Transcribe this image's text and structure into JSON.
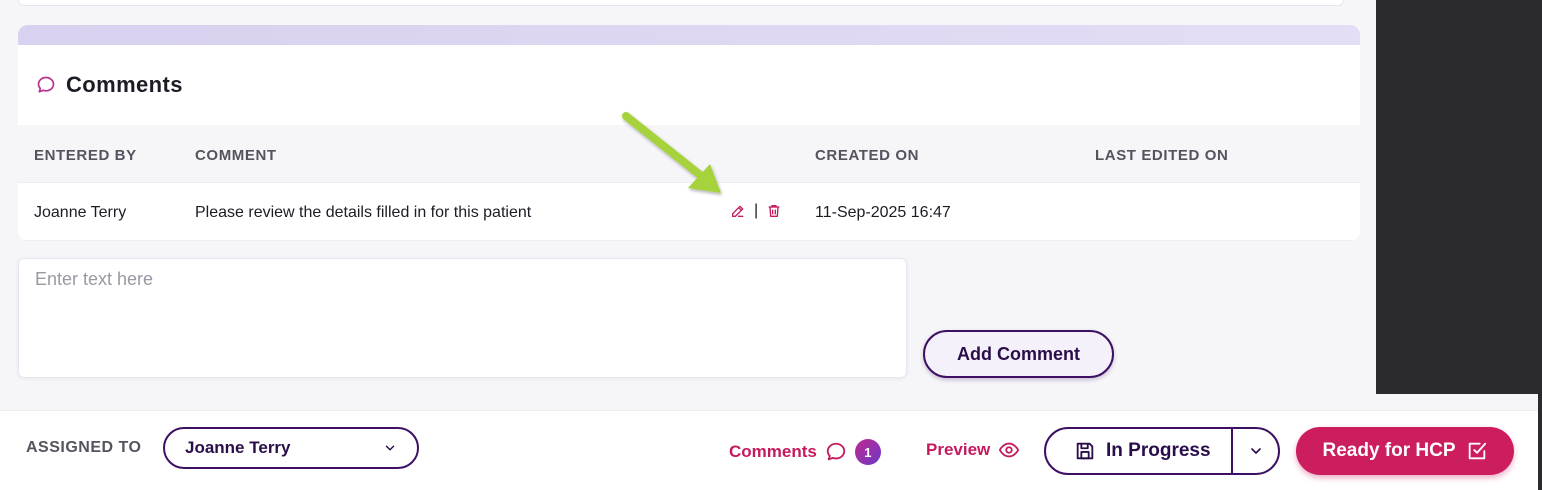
{
  "comments_section": {
    "title": "Comments",
    "columns": [
      "ENTERED BY",
      "COMMENT",
      "CREATED ON",
      "LAST EDITED ON"
    ],
    "rows": [
      {
        "entered_by": "Joanne Terry",
        "comment": "Please review the details filled in for this patient",
        "created_on": "11-Sep-2025 16:47",
        "last_edited_on": ""
      }
    ],
    "action_separator": "|",
    "input_placeholder": "Enter text here",
    "add_button_label": "Add Comment"
  },
  "footer": {
    "assigned_label": "ASSIGNED TO",
    "assignee": "Joanne Terry",
    "comments_link": "Comments",
    "comments_count": "1",
    "preview_link": "Preview",
    "status_label": "In Progress",
    "ready_button_label": "Ready for HCP"
  },
  "colors": {
    "brand_purple": "#3d1064",
    "accent_pink": "#cc1d5e",
    "arrow_green": "#a6d23a"
  }
}
